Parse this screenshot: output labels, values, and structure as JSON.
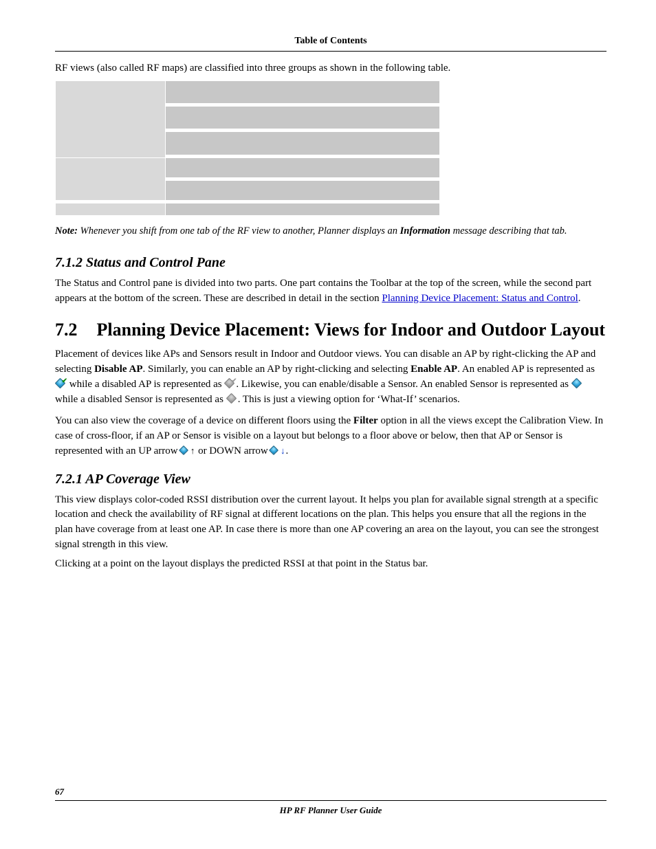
{
  "header": {
    "title": "Table of Contents"
  },
  "intro": "RF views (also called RF maps) are classified into three groups as shown in the following table.",
  "note": {
    "label": "Note:",
    "before": " Whenever you shift from one tab of the RF view to another, Planner displays an ",
    "info_word": "Information",
    "after": " message describing that tab."
  },
  "sec712": {
    "heading": "7.1.2   Status and Control Pane",
    "p1_a": "The Status and Control pane is divided into two parts. One part contains the Toolbar at the top of the screen, while the second part appears at the bottom of the screen. These are described in detail in the section ",
    "link": "Planning Device Placement: Status and Control",
    "p1_b": "."
  },
  "sec72": {
    "num": "7.2",
    "title": "Planning Device Placement: Views for Indoor and Outdoor Layout",
    "p1_a": "Placement of devices like APs and Sensors result in Indoor and Outdoor views. You can disable an AP by right-clicking the AP and selecting ",
    "disable_ap": "Disable AP",
    "p1_b": ". Similarly, you can enable an AP by right-clicking and selecting ",
    "enable_ap": "Enable AP",
    "p1_c": ". An enabled AP is represented as ",
    "p1_d": " while a disabled AP is represented as ",
    "p1_e": ". Likewise, you can enable/disable a Sensor. An enabled Sensor is represented as ",
    "p1_f": " while a disabled Sensor is represented as ",
    "p1_g": ". This is just a viewing option for ‘What-If’ scenarios.",
    "p2_a": "You can also view the coverage of a device on different floors using the ",
    "filter": "Filter",
    "p2_b": " option in all the views except the Calibration View. In case of cross-floor, if an AP or Sensor is visible on a layout but belongs to a floor above or below, then that AP or Sensor is represented with an UP arrow ",
    "p2_c": " or DOWN arrow ",
    "p2_d": "."
  },
  "sec721": {
    "heading": "7.2.1   AP Coverage View",
    "p1": "This view displays color-coded RSSI distribution over the current layout. It helps you plan for available signal strength at a specific location and check the availability of RF signal at different locations on the plan. This helps you ensure that all the regions in the plan have coverage from at least one AP. In case there is more than one AP covering an area on the layout, you can see the strongest signal strength in this view.",
    "p2": "Clicking at a point on the layout displays the predicted RSSI at that point in the Status bar."
  },
  "footer": {
    "page": "67",
    "title": "HP RF Planner User Guide"
  }
}
